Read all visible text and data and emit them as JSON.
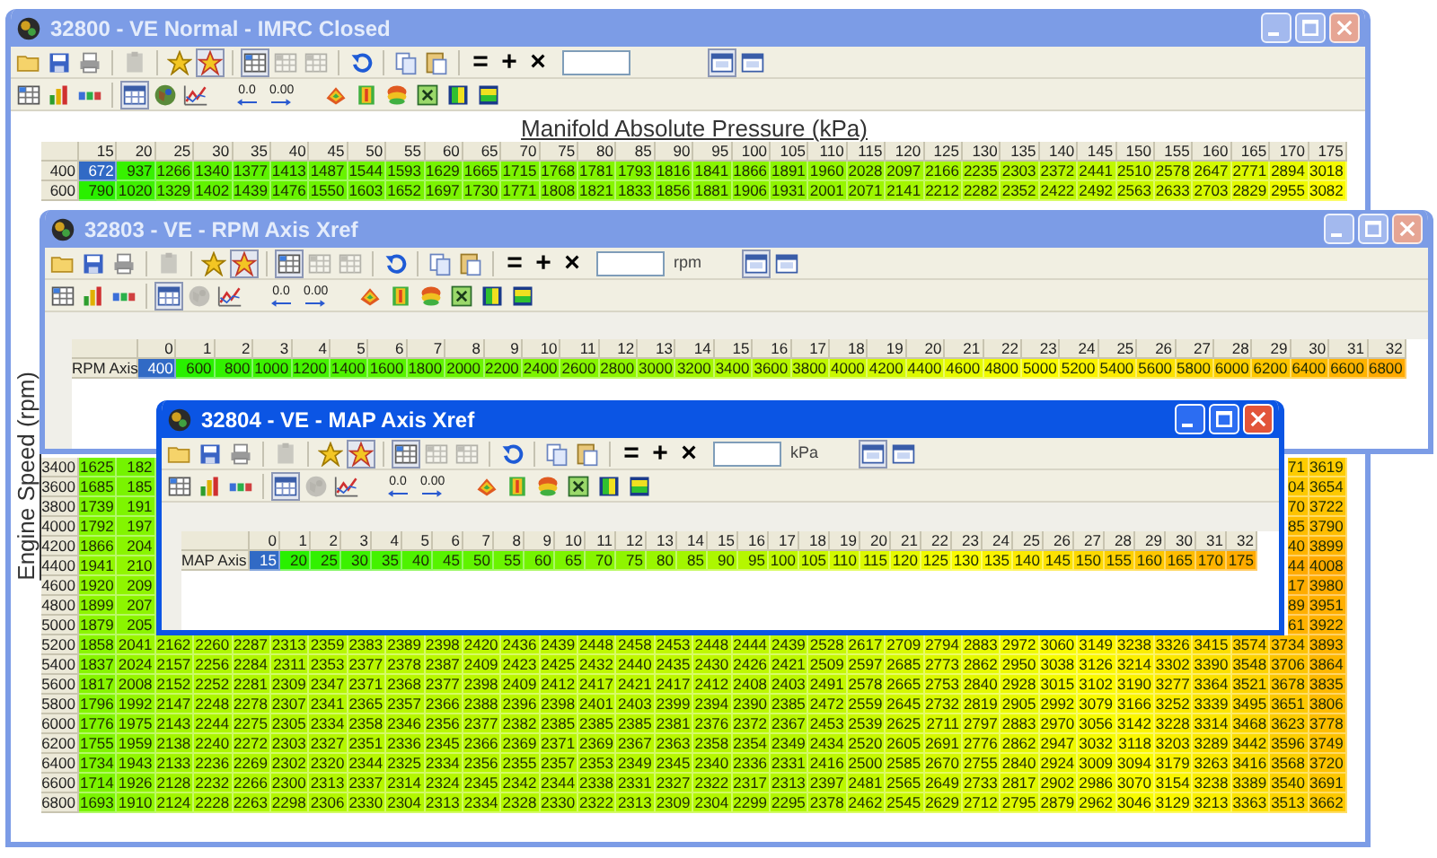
{
  "windows": [
    {
      "kind": "map",
      "title": "32800 - VE Normal - IMRC Closed",
      "active": false,
      "toolbar_rows": [
        [
          {
            "kind": "open",
            "pressed": false,
            "disabled": false
          },
          {
            "kind": "save",
            "pressed": false,
            "disabled": false
          },
          {
            "kind": "print",
            "pressed": false,
            "disabled": false
          },
          {
            "kind": "separator"
          },
          {
            "kind": "clipboard",
            "pressed": false,
            "disabled": true
          },
          {
            "kind": "separator"
          },
          {
            "kind": "favorite-add",
            "pressed": false,
            "disabled": false
          },
          {
            "kind": "favorite-list",
            "pressed": true,
            "disabled": false
          },
          {
            "kind": "separator"
          },
          {
            "kind": "cell-select",
            "pressed": true,
            "disabled": false
          },
          {
            "kind": "row-select",
            "pressed": false,
            "disabled": true
          },
          {
            "kind": "column-select",
            "pressed": false,
            "disabled": true
          },
          {
            "kind": "separator"
          },
          {
            "kind": "undo",
            "pressed": false,
            "disabled": false
          },
          {
            "kind": "separator"
          },
          {
            "kind": "copy",
            "pressed": false,
            "disabled": false
          },
          {
            "kind": "paste",
            "pressed": false,
            "disabled": false
          },
          {
            "kind": "separator"
          },
          {
            "kind": "operator",
            "text": "="
          },
          {
            "kind": "operator",
            "text": "+"
          },
          {
            "kind": "operator",
            "text": "×"
          },
          {
            "kind": "field"
          },
          {
            "kind": "view-table",
            "pressed": true,
            "disabled": false
          },
          {
            "kind": "view-split",
            "pressed": false,
            "disabled": false
          }
        ],
        [
          {
            "kind": "grid-view",
            "pressed": false,
            "disabled": false
          },
          {
            "kind": "color-chart",
            "pressed": false,
            "disabled": false
          },
          {
            "kind": "scale",
            "pressed": false,
            "disabled": false
          },
          {
            "kind": "separator"
          },
          {
            "kind": "table-view",
            "pressed": true,
            "disabled": false
          },
          {
            "kind": "globe",
            "pressed": false,
            "disabled": false
          },
          {
            "kind": "graph",
            "pressed": false,
            "disabled": false
          },
          {
            "kind": "decrease-decimals",
            "text": "0.0",
            "pressed": false,
            "disabled": false
          },
          {
            "kind": "increase-decimals",
            "text": "0.00",
            "pressed": false,
            "disabled": false
          },
          {
            "kind": "surface-a",
            "pressed": false,
            "disabled": false
          },
          {
            "kind": "surface-b",
            "pressed": false,
            "disabled": false
          },
          {
            "kind": "surface-c",
            "pressed": false,
            "disabled": false
          },
          {
            "kind": "fit",
            "pressed": false,
            "disabled": false
          },
          {
            "kind": "gradient-v",
            "pressed": false,
            "disabled": false
          },
          {
            "kind": "gradient-h",
            "pressed": false,
            "disabled": false
          }
        ]
      ],
      "table": {
        "column_axis_title": "Manifold Absolute Pressure (kPa)",
        "row_axis_title": "Engine Speed (rpm)",
        "columns": [
          "15",
          "20",
          "25",
          "30",
          "35",
          "40",
          "45",
          "50",
          "55",
          "60",
          "65",
          "70",
          "75",
          "80",
          "85",
          "90",
          "95",
          "100",
          "105",
          "110",
          "115",
          "120",
          "125",
          "130",
          "135",
          "140",
          "145",
          "150",
          "155",
          "160",
          "165",
          "170",
          "175"
        ],
        "top_rows": [
          {
            "label": "400",
            "first_cell_selected": true,
            "cells": [
              "672",
              "937",
              "1266",
              "1340",
              "1377",
              "1413",
              "1487",
              "1544",
              "1593",
              "1629",
              "1665",
              "1715",
              "1768",
              "1781",
              "1793",
              "1816",
              "1841",
              "1866",
              "1891",
              "1960",
              "2028",
              "2097",
              "2166",
              "2235",
              "2303",
              "2372",
              "2441",
              "2510",
              "2578",
              "2647",
              "2771",
              "2894",
              "3018"
            ]
          },
          {
            "label": "600",
            "first_cell_selected": false,
            "cells": [
              "790",
              "1020",
              "1329",
              "1402",
              "1439",
              "1476",
              "1550",
              "1603",
              "1652",
              "1697",
              "1730",
              "1771",
              "1808",
              "1821",
              "1833",
              "1856",
              "1881",
              "1906",
              "1931",
              "2001",
              "2071",
              "2141",
              "2212",
              "2282",
              "2352",
              "2422",
              "2492",
              "2563",
              "2633",
              "2703",
              "2829",
              "2955",
              "3082"
            ]
          }
        ],
        "bottom_rows": [
          {
            "label": "3400",
            "first_cell_selected": false,
            "cells": [
              "1625",
              {
                "text": "182",
                "clipped": true
              },
              null,
              null,
              null,
              null,
              null,
              null,
              null,
              null,
              null,
              null,
              null,
              null,
              null,
              null,
              null,
              null,
              null,
              null,
              null,
              null,
              null,
              null,
              null,
              null,
              null,
              null,
              null,
              null,
              null,
              {
                "text": "71",
                "clipped": true
              },
              "3619"
            ]
          },
          {
            "label": "3600",
            "first_cell_selected": false,
            "cells": [
              "1685",
              {
                "text": "185",
                "clipped": true
              },
              null,
              null,
              null,
              null,
              null,
              null,
              null,
              null,
              null,
              null,
              null,
              null,
              null,
              null,
              null,
              null,
              null,
              null,
              null,
              null,
              null,
              null,
              null,
              null,
              null,
              null,
              null,
              null,
              null,
              {
                "text": "04",
                "clipped": true
              },
              "3654"
            ]
          },
          {
            "label": "3800",
            "first_cell_selected": false,
            "cells": [
              "1739",
              {
                "text": "191",
                "clipped": true
              },
              null,
              null,
              null,
              null,
              null,
              null,
              null,
              null,
              null,
              null,
              null,
              null,
              null,
              null,
              null,
              null,
              null,
              null,
              null,
              null,
              null,
              null,
              null,
              null,
              null,
              null,
              null,
              null,
              null,
              {
                "text": "70",
                "clipped": true
              },
              "3722"
            ]
          },
          {
            "label": "4000",
            "first_cell_selected": false,
            "cells": [
              "1792",
              {
                "text": "197",
                "clipped": true
              },
              null,
              null,
              null,
              null,
              null,
              null,
              null,
              null,
              null,
              null,
              null,
              null,
              null,
              null,
              null,
              null,
              null,
              null,
              null,
              null,
              null,
              null,
              null,
              null,
              null,
              null,
              null,
              null,
              null,
              {
                "text": "85",
                "clipped": true
              },
              "3790"
            ]
          },
          {
            "label": "4200",
            "first_cell_selected": false,
            "cells": [
              "1866",
              {
                "text": "204",
                "clipped": true
              },
              null,
              null,
              null,
              null,
              null,
              null,
              null,
              null,
              null,
              null,
              null,
              null,
              null,
              null,
              null,
              null,
              null,
              null,
              null,
              null,
              null,
              null,
              null,
              null,
              null,
              null,
              null,
              null,
              null,
              {
                "text": "40",
                "clipped": true
              },
              "3899"
            ]
          },
          {
            "label": "4400",
            "first_cell_selected": false,
            "cells": [
              "1941",
              {
                "text": "210",
                "clipped": true
              },
              null,
              null,
              null,
              null,
              null,
              null,
              null,
              null,
              null,
              null,
              null,
              null,
              null,
              null,
              null,
              null,
              null,
              null,
              null,
              null,
              null,
              null,
              null,
              null,
              null,
              null,
              null,
              null,
              null,
              {
                "text": "44",
                "clipped": true
              },
              "4008"
            ]
          },
          {
            "label": "4600",
            "first_cell_selected": false,
            "cells": [
              "1920",
              {
                "text": "209",
                "clipped": true
              },
              null,
              null,
              null,
              null,
              null,
              null,
              null,
              null,
              null,
              null,
              null,
              null,
              null,
              null,
              null,
              null,
              null,
              null,
              null,
              null,
              null,
              null,
              null,
              null,
              null,
              null,
              null,
              null,
              null,
              {
                "text": "17",
                "clipped": true
              },
              "3980"
            ]
          },
          {
            "label": "4800",
            "first_cell_selected": false,
            "cells": [
              "1899",
              {
                "text": "207",
                "clipped": true
              },
              null,
              null,
              null,
              null,
              null,
              null,
              null,
              null,
              null,
              null,
              null,
              null,
              null,
              null,
              null,
              null,
              null,
              null,
              null,
              null,
              null,
              null,
              null,
              null,
              null,
              null,
              null,
              null,
              null,
              {
                "text": "89",
                "clipped": true
              },
              "3951"
            ]
          },
          {
            "label": "5000",
            "first_cell_selected": false,
            "cells": [
              "1879",
              {
                "text": "205",
                "clipped": true
              },
              null,
              null,
              null,
              null,
              null,
              null,
              null,
              null,
              null,
              null,
              null,
              null,
              null,
              null,
              null,
              null,
              null,
              null,
              null,
              null,
              null,
              null,
              null,
              null,
              null,
              null,
              null,
              null,
              null,
              {
                "text": "61",
                "clipped": true
              },
              "3922"
            ]
          },
          {
            "label": "5200",
            "first_cell_selected": false,
            "cells": [
              "1858",
              "2041",
              "2162",
              "2260",
              "2287",
              "2313",
              "2359",
              "2383",
              "2389",
              "2398",
              "2420",
              "2436",
              "2439",
              "2448",
              "2458",
              "2453",
              "2448",
              "2444",
              "2439",
              "2528",
              "2617",
              "2709",
              "2794",
              "2883",
              "2972",
              "3060",
              "3149",
              "3238",
              "3326",
              "3415",
              "3574",
              "3734",
              "3893"
            ]
          },
          {
            "label": "5400",
            "first_cell_selected": false,
            "cells": [
              "1837",
              "2024",
              "2157",
              "2256",
              "2284",
              "2311",
              "2353",
              "2377",
              "2378",
              "2387",
              "2409",
              "2423",
              "2425",
              "2432",
              "2440",
              "2435",
              "2430",
              "2426",
              "2421",
              "2509",
              "2597",
              "2685",
              "2773",
              "2862",
              "2950",
              "3038",
              "3126",
              "3214",
              "3302",
              "3390",
              "3548",
              "3706",
              "3864"
            ]
          },
          {
            "label": "5600",
            "first_cell_selected": false,
            "cells": [
              "1817",
              "2008",
              "2152",
              "2252",
              "2281",
              "2309",
              "2347",
              "2371",
              "2368",
              "2377",
              "2398",
              "2409",
              "2412",
              "2417",
              "2421",
              "2417",
              "2412",
              "2408",
              "2403",
              "2491",
              "2578",
              "2665",
              "2753",
              "2840",
              "2928",
              "3015",
              "3102",
              "3190",
              "3277",
              "3364",
              "3521",
              "3678",
              "3835"
            ]
          },
          {
            "label": "5800",
            "first_cell_selected": false,
            "cells": [
              "1796",
              "1992",
              "2147",
              "2248",
              "2278",
              "2307",
              "2341",
              "2365",
              "2357",
              "2366",
              "2388",
              "2396",
              "2398",
              "2401",
              "2403",
              "2399",
              "2394",
              "2390",
              "2385",
              "2472",
              "2559",
              "2645",
              "2732",
              "2819",
              "2905",
              "2992",
              "3079",
              "3166",
              "3252",
              "3339",
              "3495",
              "3651",
              "3806"
            ]
          },
          {
            "label": "6000",
            "first_cell_selected": false,
            "cells": [
              "1776",
              "1975",
              "2143",
              "2244",
              "2275",
              "2305",
              "2334",
              "2358",
              "2346",
              "2356",
              "2377",
              "2382",
              "2385",
              "2385",
              "2385",
              "2381",
              "2376",
              "2372",
              "2367",
              "2453",
              "2539",
              "2625",
              "2711",
              "2797",
              "2883",
              "2970",
              "3056",
              "3142",
              "3228",
              "3314",
              "3468",
              "3623",
              "3778"
            ]
          },
          {
            "label": "6200",
            "first_cell_selected": false,
            "cells": [
              "1755",
              "1959",
              "2138",
              "2240",
              "2272",
              "2303",
              "2327",
              "2351",
              "2336",
              "2345",
              "2366",
              "2369",
              "2371",
              "2369",
              "2367",
              "2363",
              "2358",
              "2354",
              "2349",
              "2434",
              "2520",
              "2605",
              "2691",
              "2776",
              "2862",
              "2947",
              "3032",
              "3118",
              "3203",
              "3289",
              "3442",
              "3596",
              "3749"
            ]
          },
          {
            "label": "6400",
            "first_cell_selected": false,
            "cells": [
              "1734",
              "1943",
              "2133",
              "2236",
              "2269",
              "2302",
              "2320",
              "2344",
              "2325",
              "2334",
              "2356",
              "2355",
              "2357",
              "2353",
              "2349",
              "2345",
              "2340",
              "2336",
              "2331",
              "2416",
              "2500",
              "2585",
              "2670",
              "2755",
              "2840",
              "2924",
              "3009",
              "3094",
              "3179",
              "3263",
              "3416",
              "3568",
              "3720"
            ]
          },
          {
            "label": "6600",
            "first_cell_selected": false,
            "cells": [
              "1714",
              "1926",
              "2128",
              "2232",
              "2266",
              "2300",
              "2313",
              "2337",
              "2314",
              "2324",
              "2345",
              "2342",
              "2344",
              "2338",
              "2331",
              "2327",
              "2322",
              "2317",
              "2313",
              "2397",
              "2481",
              "2565",
              "2649",
              "2733",
              "2817",
              "2902",
              "2986",
              "3070",
              "3154",
              "3238",
              "3389",
              "3540",
              "3691"
            ]
          },
          {
            "label": "6800",
            "first_cell_selected": false,
            "cells": [
              "1693",
              "1910",
              "2124",
              "2228",
              "2263",
              "2298",
              "2306",
              "2330",
              "2304",
              "2313",
              "2334",
              "2328",
              "2330",
              "2322",
              "2313",
              "2309",
              "2304",
              "2299",
              "2295",
              "2378",
              "2462",
              "2545",
              "2629",
              "2712",
              "2795",
              "2879",
              "2962",
              "3046",
              "3129",
              "3213",
              "3363",
              "3513",
              "3662"
            ]
          }
        ]
      }
    },
    {
      "kind": "axis",
      "title": "32803 - VE - RPM Axis Xref",
      "active": false,
      "toolbar_rows": [
        [
          {
            "kind": "open",
            "pressed": false,
            "disabled": false
          },
          {
            "kind": "save",
            "pressed": false,
            "disabled": false
          },
          {
            "kind": "print",
            "pressed": false,
            "disabled": false
          },
          {
            "kind": "separator"
          },
          {
            "kind": "clipboard",
            "pressed": false,
            "disabled": true
          },
          {
            "kind": "separator"
          },
          {
            "kind": "favorite-add",
            "pressed": false,
            "disabled": false
          },
          {
            "kind": "favorite-list",
            "pressed": true,
            "disabled": false
          },
          {
            "kind": "separator"
          },
          {
            "kind": "cell-select",
            "pressed": true,
            "disabled": false
          },
          {
            "kind": "row-select",
            "pressed": false,
            "disabled": true
          },
          {
            "kind": "column-select",
            "pressed": false,
            "disabled": true
          },
          {
            "kind": "separator"
          },
          {
            "kind": "undo",
            "pressed": false,
            "disabled": false
          },
          {
            "kind": "separator"
          },
          {
            "kind": "copy",
            "pressed": false,
            "disabled": false
          },
          {
            "kind": "paste",
            "pressed": false,
            "disabled": false
          },
          {
            "kind": "separator"
          },
          {
            "kind": "operator",
            "text": "="
          },
          {
            "kind": "operator",
            "text": "+"
          },
          {
            "kind": "operator",
            "text": "×"
          },
          {
            "kind": "field",
            "unit": "rpm"
          },
          {
            "kind": "view-table",
            "pressed": true,
            "disabled": false
          },
          {
            "kind": "view-split",
            "pressed": false,
            "disabled": false
          }
        ],
        [
          {
            "kind": "grid-view",
            "pressed": false,
            "disabled": false
          },
          {
            "kind": "color-chart",
            "pressed": false,
            "disabled": false
          },
          {
            "kind": "scale",
            "pressed": false,
            "disabled": false
          },
          {
            "kind": "separator"
          },
          {
            "kind": "table-view",
            "pressed": true,
            "disabled": false
          },
          {
            "kind": "globe",
            "pressed": false,
            "disabled": true
          },
          {
            "kind": "graph",
            "pressed": false,
            "disabled": false
          },
          {
            "kind": "decrease-decimals",
            "text": "0.0",
            "pressed": false,
            "disabled": false
          },
          {
            "kind": "increase-decimals",
            "text": "0.00",
            "pressed": false,
            "disabled": false
          },
          {
            "kind": "surface-a",
            "pressed": false,
            "disabled": false
          },
          {
            "kind": "surface-b",
            "pressed": false,
            "disabled": false
          },
          {
            "kind": "surface-c",
            "pressed": false,
            "disabled": false
          },
          {
            "kind": "fit",
            "pressed": false,
            "disabled": false
          },
          {
            "kind": "gradient-v",
            "pressed": false,
            "disabled": false
          },
          {
            "kind": "gradient-h",
            "pressed": false,
            "disabled": false
          }
        ]
      ],
      "table": {
        "columns": [
          "0",
          "1",
          "2",
          "3",
          "4",
          "5",
          "6",
          "7",
          "8",
          "9",
          "10",
          "11",
          "12",
          "13",
          "14",
          "15",
          "16",
          "17",
          "18",
          "19",
          "20",
          "21",
          "22",
          "23",
          "24",
          "25",
          "26",
          "27",
          "28",
          "29",
          "30",
          "31",
          "32"
        ],
        "rows": [
          {
            "label": "RPM Axis",
            "first_cell_selected": true,
            "cells": [
              "400",
              "600",
              "800",
              "1000",
              "1200",
              "1400",
              "1600",
              "1800",
              "2000",
              "2200",
              "2400",
              "2600",
              "2800",
              "3000",
              "3200",
              "3400",
              "3600",
              "3800",
              "4000",
              "4200",
              "4400",
              "4600",
              "4800",
              "5000",
              "5200",
              "5400",
              "5600",
              "5800",
              "6000",
              "6200",
              "6400",
              "6600",
              "6800"
            ]
          }
        ]
      }
    },
    {
      "kind": "axis",
      "title": "32804 - VE - MAP Axis Xref",
      "active": true,
      "toolbar_rows": [
        [
          {
            "kind": "open",
            "pressed": false,
            "disabled": false
          },
          {
            "kind": "save",
            "pressed": false,
            "disabled": false
          },
          {
            "kind": "print",
            "pressed": false,
            "disabled": false
          },
          {
            "kind": "separator"
          },
          {
            "kind": "clipboard",
            "pressed": false,
            "disabled": true
          },
          {
            "kind": "separator"
          },
          {
            "kind": "favorite-add",
            "pressed": false,
            "disabled": false
          },
          {
            "kind": "favorite-list",
            "pressed": true,
            "disabled": false
          },
          {
            "kind": "separator"
          },
          {
            "kind": "cell-select",
            "pressed": true,
            "disabled": false
          },
          {
            "kind": "row-select",
            "pressed": false,
            "disabled": true
          },
          {
            "kind": "column-select",
            "pressed": false,
            "disabled": true
          },
          {
            "kind": "separator"
          },
          {
            "kind": "undo",
            "pressed": false,
            "disabled": false
          },
          {
            "kind": "separator"
          },
          {
            "kind": "copy",
            "pressed": false,
            "disabled": false
          },
          {
            "kind": "paste",
            "pressed": false,
            "disabled": false
          },
          {
            "kind": "separator"
          },
          {
            "kind": "operator",
            "text": "="
          },
          {
            "kind": "operator",
            "text": "+"
          },
          {
            "kind": "operator",
            "text": "×"
          },
          {
            "kind": "field",
            "unit": "kPa"
          },
          {
            "kind": "view-table",
            "pressed": true,
            "disabled": false
          },
          {
            "kind": "view-split",
            "pressed": false,
            "disabled": false
          }
        ],
        [
          {
            "kind": "grid-view",
            "pressed": false,
            "disabled": false
          },
          {
            "kind": "color-chart",
            "pressed": false,
            "disabled": false
          },
          {
            "kind": "scale",
            "pressed": false,
            "disabled": false
          },
          {
            "kind": "separator"
          },
          {
            "kind": "table-view",
            "pressed": true,
            "disabled": false
          },
          {
            "kind": "globe",
            "pressed": false,
            "disabled": true
          },
          {
            "kind": "graph",
            "pressed": false,
            "disabled": false
          },
          {
            "kind": "decrease-decimals",
            "text": "0.0",
            "pressed": false,
            "disabled": false
          },
          {
            "kind": "increase-decimals",
            "text": "0.00",
            "pressed": false,
            "disabled": false
          },
          {
            "kind": "surface-a",
            "pressed": false,
            "disabled": false
          },
          {
            "kind": "surface-b",
            "pressed": false,
            "disabled": false
          },
          {
            "kind": "surface-c",
            "pressed": false,
            "disabled": false
          },
          {
            "kind": "fit",
            "pressed": false,
            "disabled": false
          },
          {
            "kind": "gradient-v",
            "pressed": false,
            "disabled": false
          },
          {
            "kind": "gradient-h",
            "pressed": false,
            "disabled": false
          }
        ]
      ],
      "table": {
        "columns": [
          "0",
          "1",
          "2",
          "3",
          "4",
          "5",
          "6",
          "7",
          "8",
          "9",
          "10",
          "11",
          "12",
          "13",
          "14",
          "15",
          "16",
          "17",
          "18",
          "19",
          "20",
          "21",
          "22",
          "23",
          "24",
          "25",
          "26",
          "27",
          "28",
          "29",
          "30",
          "31",
          "32"
        ],
        "rows": [
          {
            "label": "MAP Axis",
            "first_cell_selected": true,
            "cells": [
              "15",
              "20",
              "25",
              "30",
              "35",
              "40",
              "45",
              "50",
              "55",
              "60",
              "65",
              "70",
              "75",
              "80",
              "85",
              "90",
              "95",
              "100",
              "105",
              "110",
              "115",
              "120",
              "125",
              "130",
              "135",
              "140",
              "145",
              "150",
              "155",
              "160",
              "165",
              "170",
              "175"
            ]
          }
        ]
      }
    }
  ]
}
